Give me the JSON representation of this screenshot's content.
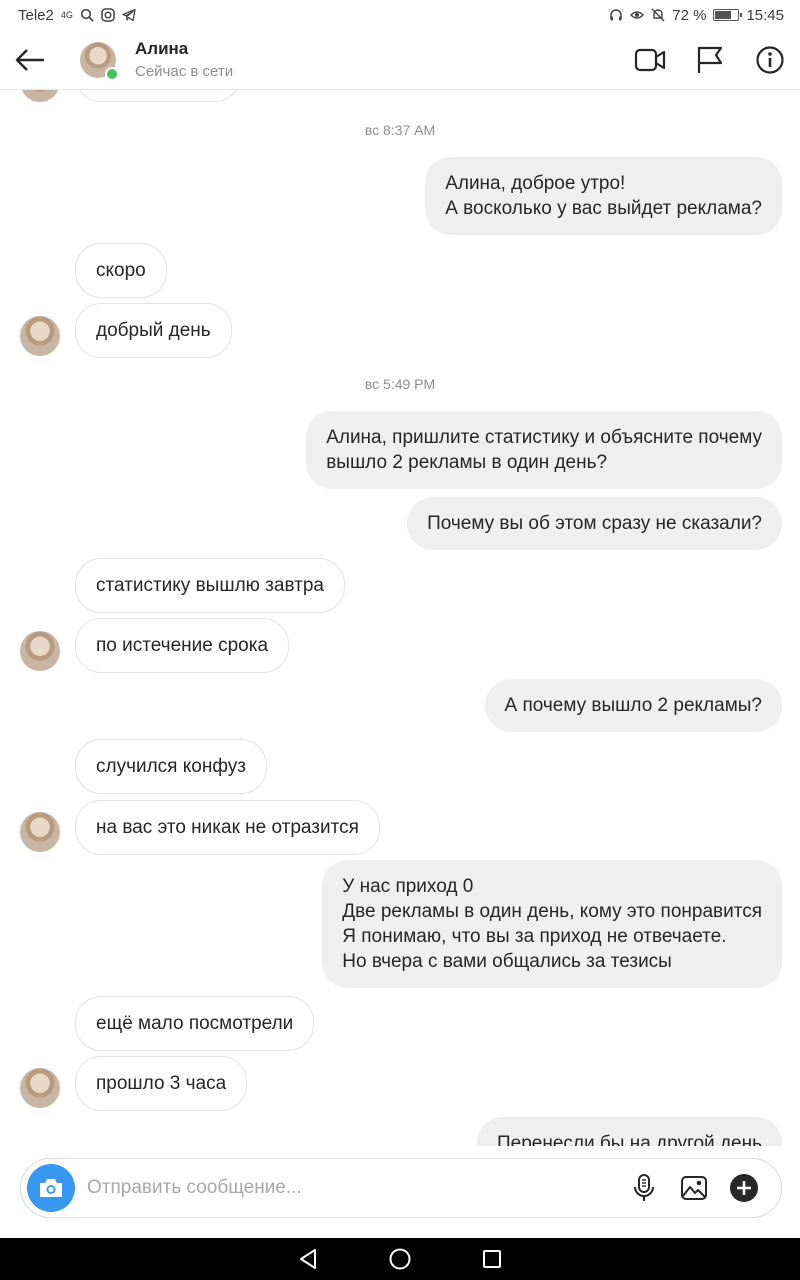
{
  "status_bar": {
    "carrier": "Tele2",
    "network": "4G",
    "battery_text": "72 %",
    "battery_level": 0.72,
    "time": "15:45"
  },
  "header": {
    "back_icon": "arrow-left-icon",
    "contact_name": "Алина",
    "contact_status": "Сейчас в сети",
    "online": true,
    "actions": [
      "video-call-icon",
      "flag-icon",
      "info-icon"
    ]
  },
  "chat": {
    "messages": [
      {
        "kind": "timestamp",
        "text": "вс 8:37 AM"
      },
      {
        "kind": "out",
        "text": "Алина, доброе утро!\nА восколько у вас выйдет реклама?"
      },
      {
        "kind": "in",
        "text": "скоро"
      },
      {
        "kind": "in",
        "text": "добрый день"
      },
      {
        "kind": "timestamp",
        "text": "вс 5:49 PM"
      },
      {
        "kind": "out",
        "text": "Алина, пришлите статистику и объясните почему\nвышло 2 рекламы в один день?"
      },
      {
        "kind": "out",
        "text": "Почему вы об этом сразу не сказали?"
      },
      {
        "kind": "in",
        "text": "статистику вышлю завтра"
      },
      {
        "kind": "in",
        "text": "по истечение срока"
      },
      {
        "kind": "out",
        "text": "А почему вышло 2 рекламы?"
      },
      {
        "kind": "in",
        "text": "случился конфуз"
      },
      {
        "kind": "in",
        "text": "на вас это никак не отразится"
      },
      {
        "kind": "out",
        "text": "У нас приход 0\nДве рекламы в один день, кому это понравится\nЯ понимаю, что вы за приход не отвечаете.\nНо вчера с вами общались за тезисы"
      },
      {
        "kind": "in",
        "text": "ещё мало посмотрели"
      },
      {
        "kind": "in",
        "text": "прошло 3 часа"
      },
      {
        "kind": "out",
        "text": "Перенесли бы на другой день"
      }
    ]
  },
  "composer": {
    "placeholder": "Отправить сообщение...",
    "value": "",
    "icons": [
      "camera-icon",
      "microphone-icon",
      "gallery-icon",
      "plus-icon"
    ]
  },
  "nav": {
    "icons": [
      "back-triangle-icon",
      "home-circle-icon",
      "recents-square-icon"
    ]
  }
}
